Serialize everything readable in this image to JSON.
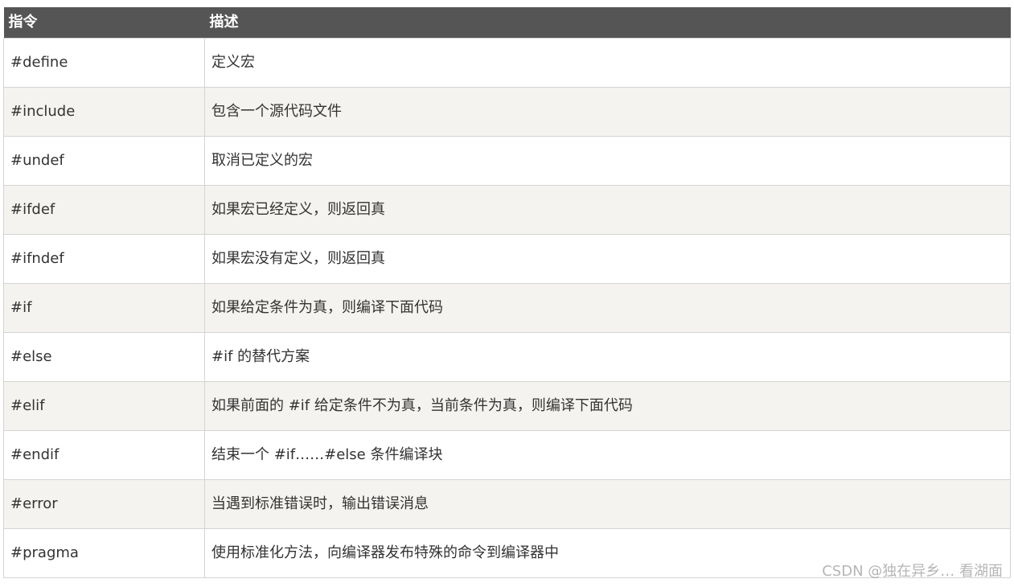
{
  "table": {
    "headers": [
      "指令",
      "描述"
    ],
    "rows": [
      [
        "#define",
        "定义宏"
      ],
      [
        "#include",
        "包含一个源代码文件"
      ],
      [
        "#undef",
        "取消已定义的宏"
      ],
      [
        "#ifdef",
        "如果宏已经定义，则返回真"
      ],
      [
        "#ifndef",
        "如果宏没有定义，则返回真"
      ],
      [
        "#if",
        "如果给定条件为真，则编译下面代码"
      ],
      [
        "#else",
        "#if 的替代方案"
      ],
      [
        "#elif",
        "如果前面的 #if 给定条件不为真，当前条件为真，则编译下面代码"
      ],
      [
        "#endif",
        "结束一个 #if……#else 条件编译块"
      ],
      [
        "#error",
        "当遇到标准错误时，输出错误消息"
      ],
      [
        "#pragma",
        "使用标准化方法，向编译器发布特殊的命令到编译器中"
      ]
    ]
  },
  "watermark": "CSDN @独在异乡… 看湖面"
}
